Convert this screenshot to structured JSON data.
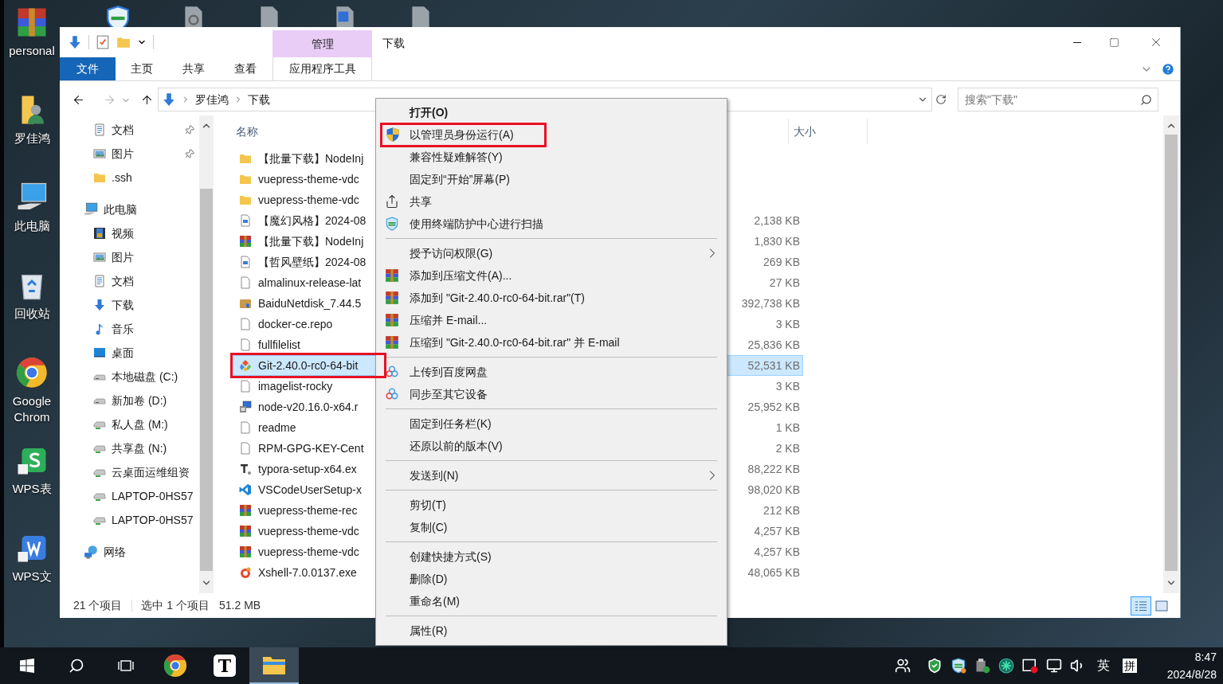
{
  "desktop": {
    "icons": [
      {
        "label": "personal",
        "kind": "archive"
      },
      {
        "label": "罗佳鸿",
        "kind": "user-folder"
      },
      {
        "label": "此电脑",
        "kind": "computer-big"
      },
      {
        "label": "回收站",
        "kind": "recycle"
      },
      {
        "label": "Google Chrom",
        "kind": "browser"
      },
      {
        "label": "WPS表",
        "kind": "sheet"
      },
      {
        "label": "WPS文",
        "kind": "writer"
      }
    ]
  },
  "window": {
    "title": "下载",
    "context_group": "管理",
    "context_tab": "应用程序工具",
    "ribbon_tabs": [
      {
        "label": "文件",
        "kind": "file"
      },
      {
        "label": "主页",
        "kind": "tab"
      },
      {
        "label": "共享",
        "kind": "tab"
      },
      {
        "label": "查看",
        "kind": "tab"
      }
    ],
    "address": {
      "path": [
        "罗佳鸿",
        "下载"
      ]
    },
    "search": {
      "placeholder": "搜索\"下载\""
    }
  },
  "nav": {
    "quick_access": [
      {
        "label": "文档",
        "kind": "document",
        "pinned": true
      },
      {
        "label": "图片",
        "kind": "pictures",
        "pinned": true
      },
      {
        "label": ".ssh",
        "kind": "folder",
        "pinned": false
      }
    ],
    "tree": [
      {
        "label": "此电脑",
        "kind": "computer",
        "children": [
          {
            "label": "视频",
            "kind": "video"
          },
          {
            "label": "图片",
            "kind": "pictures"
          },
          {
            "label": "文档",
            "kind": "document"
          },
          {
            "label": "下载",
            "kind": "download"
          },
          {
            "label": "音乐",
            "kind": "music"
          },
          {
            "label": "桌面",
            "kind": "desktop"
          },
          {
            "label": "本地磁盘 (C:)",
            "kind": "drive"
          },
          {
            "label": "新加卷 (D:)",
            "kind": "drive"
          },
          {
            "label": "私人盘 (M:)",
            "kind": "netdrive"
          },
          {
            "label": "共享盘 (N:)",
            "kind": "netdrive"
          },
          {
            "label": "云桌面运维组资",
            "kind": "netdrive"
          },
          {
            "label": "LAPTOP-0HS57",
            "kind": "netdrive"
          },
          {
            "label": "LAPTOP-0HS57",
            "kind": "netdrive"
          }
        ]
      },
      {
        "label": "网络",
        "kind": "network"
      }
    ]
  },
  "file_list": {
    "columns": [
      "名称",
      "大小"
    ],
    "rows": [
      {
        "name": "【批量下载】NodeInj",
        "kind": "folder",
        "selected": false,
        "annotated": false
      },
      {
        "name": "vuepress-theme-vdc",
        "kind": "folder",
        "selected": false,
        "annotated": false
      },
      {
        "name": "vuepress-theme-vdc",
        "kind": "folder",
        "selected": false,
        "annotated": false
      },
      {
        "name": "【魔幻风格】2024-08",
        "size": "2,138 KB",
        "kind": "image",
        "selected": false,
        "annotated": false
      },
      {
        "name": "【批量下载】NodeInj",
        "size": "1,830 KB",
        "kind": "archive",
        "selected": false,
        "annotated": false
      },
      {
        "name": "【哲风壁纸】2024-08",
        "size": "269 KB",
        "kind": "image",
        "selected": false,
        "annotated": false
      },
      {
        "name": "almalinux-release-lat",
        "size": "27 KB",
        "kind": "file",
        "selected": false,
        "annotated": false
      },
      {
        "name": "BaiduNetdisk_7.44.5",
        "size": "392,738 KB",
        "kind": "package",
        "selected": false,
        "annotated": false
      },
      {
        "name": "docker-ce.repo",
        "size": "3 KB",
        "kind": "file",
        "selected": false,
        "annotated": false
      },
      {
        "name": "fullfilelist",
        "size": "25,836 KB",
        "kind": "file",
        "selected": false,
        "annotated": false
      },
      {
        "name": "Git-2.40.0-rc0-64-bit",
        "size": "52,531 KB",
        "kind": "diamond",
        "selected": true,
        "annotated": true
      },
      {
        "name": "imagelist-rocky",
        "size": "3 KB",
        "kind": "file",
        "selected": false,
        "annotated": false
      },
      {
        "name": "node-v20.16.0-x64.r",
        "size": "25,952 KB",
        "kind": "setup",
        "selected": false,
        "annotated": false
      },
      {
        "name": "readme",
        "size": "1 KB",
        "kind": "file",
        "selected": false,
        "annotated": false
      },
      {
        "name": "RPM-GPG-KEY-Cent",
        "size": "2 KB",
        "kind": "file",
        "selected": false,
        "annotated": false
      },
      {
        "name": "typora-setup-x64.ex",
        "size": "88,222 KB",
        "kind": "appfile",
        "selected": false,
        "annotated": false
      },
      {
        "name": "VSCodeUserSetup-x",
        "size": "98,020 KB",
        "kind": "editor",
        "selected": false,
        "annotated": false
      },
      {
        "name": "vuepress-theme-rec",
        "size": "212 KB",
        "kind": "archive",
        "selected": false,
        "annotated": false
      },
      {
        "name": "vuepress-theme-vdc",
        "size": "4,257 KB",
        "kind": "archive",
        "selected": false,
        "annotated": false
      },
      {
        "name": "vuepress-theme-vdc",
        "size": "4,257 KB",
        "kind": "archive",
        "selected": false,
        "annotated": false
      },
      {
        "name": "Xshell-7.0.0137.exe",
        "size": "48,065 KB",
        "kind": "applogo",
        "selected": false,
        "annotated": false
      }
    ]
  },
  "status_bar": {
    "count": "21 个项目",
    "selection": "选中 1 个项目",
    "size": "51.2 MB",
    "views": [
      {
        "kind": "details",
        "selected": true
      },
      {
        "kind": "large-icons",
        "selected": false
      }
    ]
  },
  "context_menu": {
    "groups": [
      [
        {
          "label": "打开(O)",
          "kind": "plain",
          "bold": true,
          "submenu": false,
          "annotated": false
        },
        {
          "label": "以管理员身份运行(A)",
          "kind": "uac",
          "bold": false,
          "submenu": false,
          "annotated": true
        },
        {
          "label": "兼容性疑难解答(Y)",
          "kind": "plain",
          "bold": false,
          "submenu": false,
          "annotated": false
        },
        {
          "label": "固定到“开始”屏幕(P)",
          "kind": "plain",
          "bold": false,
          "submenu": false,
          "annotated": false
        },
        {
          "label": "共享",
          "kind": "share",
          "bold": false,
          "submenu": false,
          "annotated": false
        },
        {
          "label": "使用终端防护中心进行扫描",
          "kind": "security",
          "bold": false,
          "submenu": false,
          "annotated": false
        }
      ],
      [
        {
          "label": "授予访问权限(G)",
          "kind": "plain",
          "bold": false,
          "submenu": true,
          "annotated": false
        },
        {
          "label": "添加到压缩文件(A)...",
          "kind": "archive",
          "bold": false,
          "submenu": false,
          "annotated": false
        },
        {
          "label": "添加到 \"Git-2.40.0-rc0-64-bit.rar\"(T)",
          "kind": "archive",
          "bold": false,
          "submenu": false,
          "annotated": false
        },
        {
          "label": "压缩并 E-mail...",
          "kind": "archive",
          "bold": false,
          "submenu": false,
          "annotated": false
        },
        {
          "label": "压缩到 \"Git-2.40.0-rc0-64-bit.rar\" 并 E-mail",
          "kind": "archive",
          "bold": false,
          "submenu": false,
          "annotated": false
        }
      ],
      [
        {
          "label": "上传到百度网盘",
          "kind": "cloud",
          "bold": false,
          "submenu": false,
          "annotated": false
        },
        {
          "label": "同步至其它设备",
          "kind": "cloud",
          "bold": false,
          "submenu": false,
          "annotated": false
        }
      ],
      [
        {
          "label": "固定到任务栏(K)",
          "kind": "plain",
          "bold": false,
          "submenu": false,
          "annotated": false
        },
        {
          "label": "还原以前的版本(V)",
          "kind": "plain",
          "bold": false,
          "submenu": false,
          "annotated": false
        }
      ],
      [
        {
          "label": "发送到(N)",
          "kind": "plain",
          "bold": false,
          "submenu": true,
          "annotated": false
        }
      ],
      [
        {
          "label": "剪切(T)",
          "kind": "plain",
          "bold": false,
          "submenu": false,
          "annotated": false
        },
        {
          "label": "复制(C)",
          "kind": "plain",
          "bold": false,
          "submenu": false,
          "annotated": false
        }
      ],
      [
        {
          "label": "创建快捷方式(S)",
          "kind": "plain",
          "bold": false,
          "submenu": false,
          "annotated": false
        },
        {
          "label": "删除(D)",
          "kind": "plain",
          "bold": false,
          "submenu": false,
          "annotated": false
        },
        {
          "label": "重命名(M)",
          "kind": "plain",
          "bold": false,
          "submenu": false,
          "annotated": false
        }
      ],
      [
        {
          "label": "属性(R)",
          "kind": "plain",
          "bold": false,
          "submenu": false,
          "annotated": false
        }
      ]
    ]
  },
  "taskbar": {
    "apps": [
      {
        "kind": "windows",
        "active": false
      },
      {
        "kind": "search",
        "active": false
      },
      {
        "kind": "task-view",
        "active": false
      },
      {
        "kind": "browser",
        "active": false
      },
      {
        "kind": "typora",
        "label": "T",
        "active": false
      },
      {
        "kind": "explorer",
        "active": true
      }
    ],
    "tray": [
      {
        "kind": "people"
      },
      {
        "kind": "defender"
      },
      {
        "kind": "security"
      },
      {
        "kind": "usb"
      },
      {
        "kind": "green-app"
      },
      {
        "kind": "alert-app"
      },
      {
        "kind": "network"
      },
      {
        "kind": "volume"
      }
    ],
    "language": "英",
    "ime": "拼",
    "time": "8:47",
    "date": "2024/8/28"
  }
}
